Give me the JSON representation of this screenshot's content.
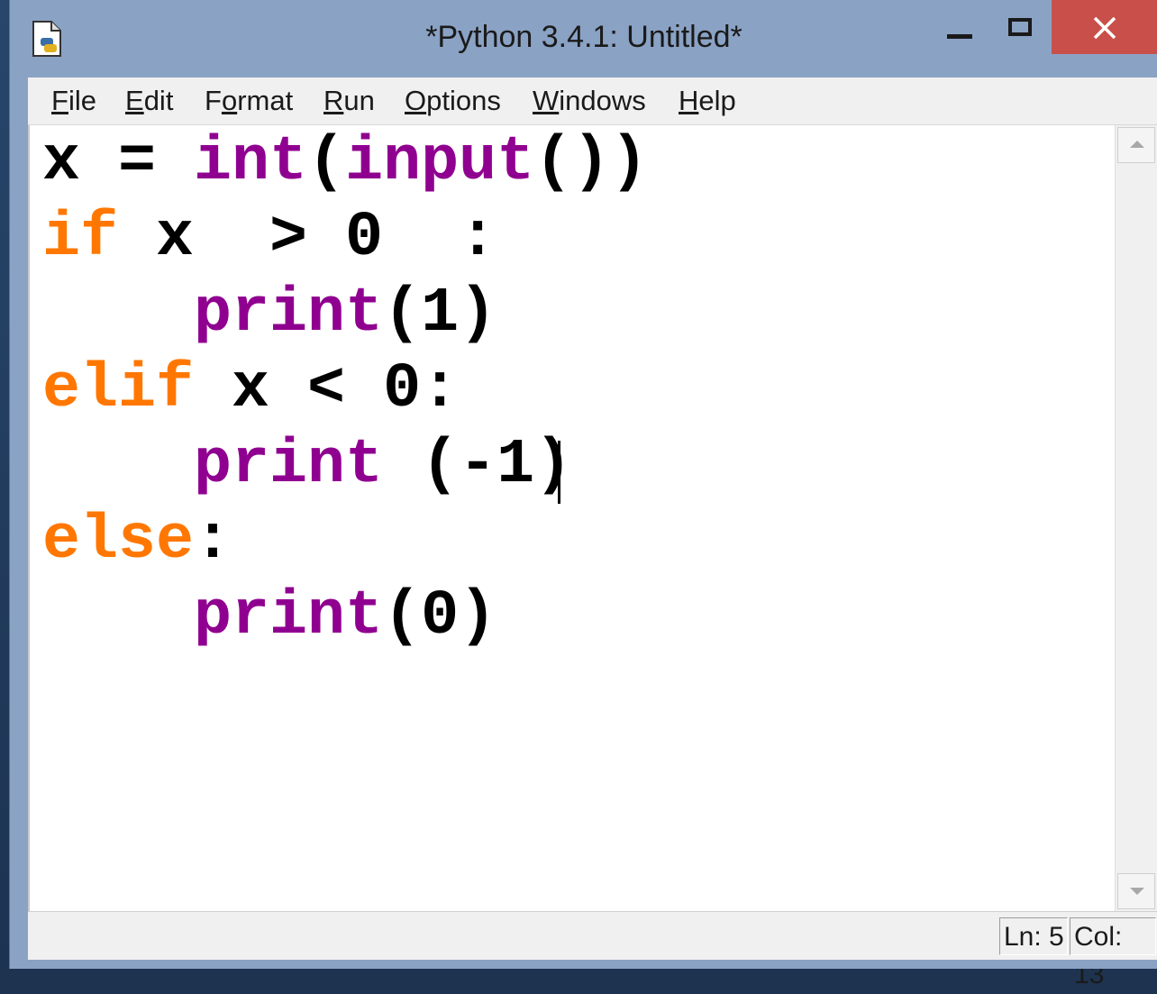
{
  "window": {
    "title": "*Python 3.4.1: Untitled*"
  },
  "menubar": {
    "items": [
      {
        "label": "File",
        "mnemonic": "F",
        "rest": "ile"
      },
      {
        "label": "Edit",
        "mnemonic": "E",
        "rest": "dit"
      },
      {
        "label": "Format",
        "pre": "F",
        "mnemonic": "o",
        "rest": "rmat"
      },
      {
        "label": "Run",
        "mnemonic": "R",
        "rest": "un"
      },
      {
        "label": "Options",
        "mnemonic": "O",
        "rest": "ptions"
      },
      {
        "label": "Windows",
        "mnemonic": "W",
        "rest": "indows"
      },
      {
        "label": "Help",
        "mnemonic": "H",
        "rest": "elp"
      }
    ]
  },
  "editor": {
    "lines": [
      {
        "segments": [
          {
            "t": "x = ",
            "c": "tx"
          },
          {
            "t": "int",
            "c": "bi"
          },
          {
            "t": "(",
            "c": "tx"
          },
          {
            "t": "input",
            "c": "bi"
          },
          {
            "t": "())",
            "c": "tx"
          }
        ]
      },
      {
        "segments": [
          {
            "t": "if",
            "c": "kw"
          },
          {
            "t": " x  > 0  :",
            "c": "tx"
          }
        ]
      },
      {
        "segments": [
          {
            "t": "    ",
            "c": "tx"
          },
          {
            "t": "print",
            "c": "bi"
          },
          {
            "t": "(1)",
            "c": "tx"
          }
        ]
      },
      {
        "segments": [
          {
            "t": "elif",
            "c": "kw"
          },
          {
            "t": " x < 0:",
            "c": "tx"
          }
        ]
      },
      {
        "segments": [
          {
            "t": "    ",
            "c": "tx"
          },
          {
            "t": "print",
            "c": "bi"
          },
          {
            "t": " (-1)",
            "c": "tx"
          }
        ]
      },
      {
        "segments": [
          {
            "t": "else",
            "c": "kw"
          },
          {
            "t": ":",
            "c": "tx"
          }
        ]
      },
      {
        "segments": [
          {
            "t": "    ",
            "c": "tx"
          },
          {
            "t": "print",
            "c": "bi"
          },
          {
            "t": "(0)",
            "c": "tx"
          }
        ]
      }
    ]
  },
  "statusbar": {
    "line": "Ln: 5",
    "col": "Col: 13"
  },
  "colors": {
    "keyword": "#ff7700",
    "builtin": "#900090",
    "close_button": "#c9504a",
    "frame": "#8aa2c4"
  }
}
